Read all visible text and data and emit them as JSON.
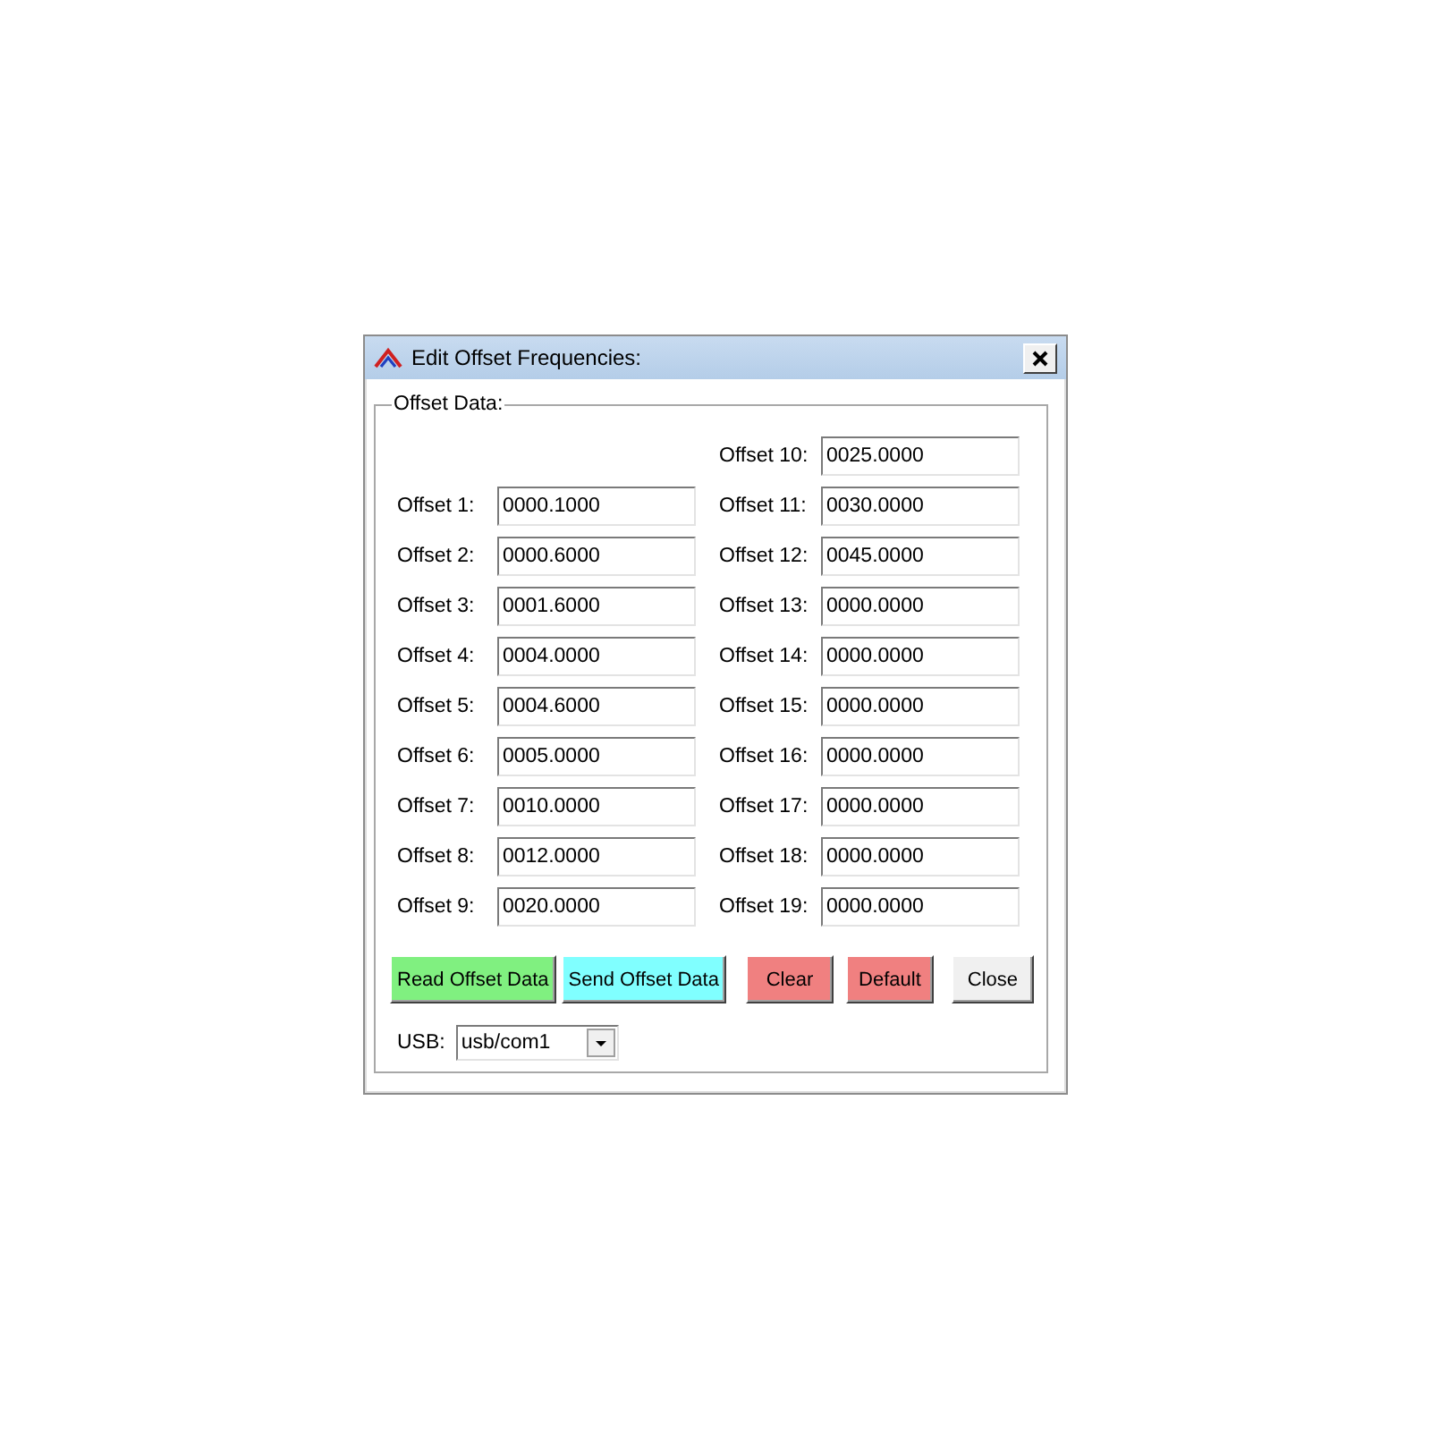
{
  "window": {
    "title": "Edit Offset Frequencies:"
  },
  "group": {
    "title": "Offset Data:",
    "left_column": [
      {
        "label": "Offset 1:",
        "value": "0000.1000"
      },
      {
        "label": "Offset 2:",
        "value": "0000.6000"
      },
      {
        "label": "Offset 3:",
        "value": "0001.6000"
      },
      {
        "label": "Offset 4:",
        "value": "0004.0000"
      },
      {
        "label": "Offset 5:",
        "value": "0004.6000"
      },
      {
        "label": "Offset 6:",
        "value": "0005.0000"
      },
      {
        "label": "Offset 7:",
        "value": "0010.0000"
      },
      {
        "label": "Offset 8:",
        "value": "0012.0000"
      },
      {
        "label": "Offset 9:",
        "value": "0020.0000"
      }
    ],
    "right_column": [
      {
        "label": "Offset 10:",
        "value": "0025.0000"
      },
      {
        "label": "Offset 11:",
        "value": "0030.0000"
      },
      {
        "label": "Offset 12:",
        "value": "0045.0000"
      },
      {
        "label": "Offset 13:",
        "value": "0000.0000"
      },
      {
        "label": "Offset 14:",
        "value": "0000.0000"
      },
      {
        "label": "Offset 15:",
        "value": "0000.0000"
      },
      {
        "label": "Offset 16:",
        "value": "0000.0000"
      },
      {
        "label": "Offset 17:",
        "value": "0000.0000"
      },
      {
        "label": "Offset 18:",
        "value": "0000.0000"
      },
      {
        "label": "Offset 19:",
        "value": "0000.0000"
      }
    ]
  },
  "buttons": [
    {
      "label": "Read Offset Data",
      "color": "#80f080"
    },
    {
      "label": "Send Offset Data",
      "color": "#80ffff"
    },
    {
      "label": "Clear",
      "color": "#f08080"
    },
    {
      "label": "Default",
      "color": "#f08080"
    },
    {
      "label": "Close",
      "color": "#f0f0f0"
    }
  ],
  "usb": {
    "label": "USB:",
    "value": "usb/com1"
  }
}
